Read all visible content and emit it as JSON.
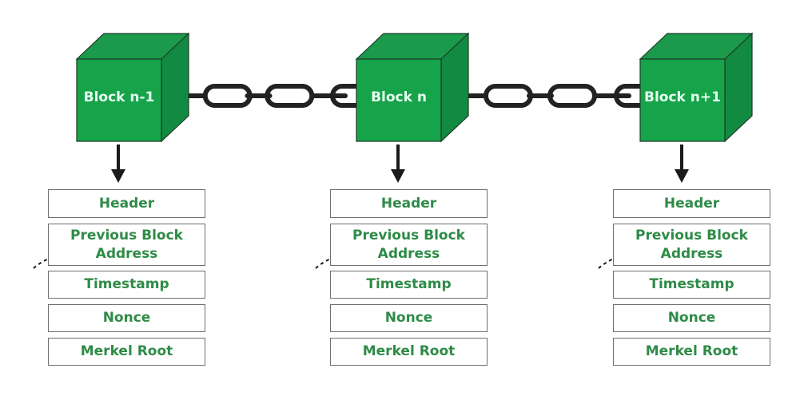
{
  "colors": {
    "block_front": "#16a34a",
    "block_top": "#1b9a4c",
    "block_side": "#138a42",
    "block_label": "#e6fff0",
    "field_text": "#2e8b47",
    "chain": "#222222"
  },
  "blocks": [
    {
      "label": "Block n-1",
      "fields": [
        "Header",
        "Previous Block Address",
        "Timestamp",
        "Nonce",
        "Merkel Root"
      ],
      "prev_field_lines": [
        "Previous Block",
        "Address"
      ]
    },
    {
      "label": "Block n",
      "fields": [
        "Header",
        "Previous Block Address",
        "Timestamp",
        "Nonce",
        "Merkel Root"
      ],
      "prev_field_lines": [
        "Previous Block",
        "Address"
      ]
    },
    {
      "label": "Block n+1",
      "fields": [
        "Header",
        "Previous Block Address",
        "Timestamp",
        "Nonce",
        "Merkel Root"
      ],
      "prev_field_lines": [
        "Previous Block",
        "Address"
      ]
    }
  ],
  "connectors": {
    "chain_links_between_blocks": 2,
    "dashed_arrow_target": "Previous Block Address"
  }
}
